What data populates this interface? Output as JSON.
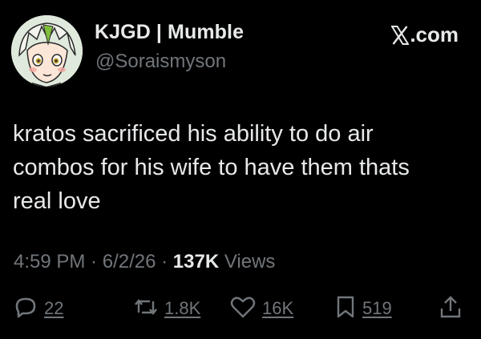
{
  "author": {
    "display_name": "KJGD | Mumble",
    "handle": "@Soraismyson",
    "avatar_icon": "anime-avatar"
  },
  "brand": {
    "label": ".com",
    "icon": "x-logo-icon"
  },
  "tweet": {
    "lines": [
      "kratos sacrificed his ability to do air",
      "combos for his wife to have them thats",
      "real love"
    ]
  },
  "meta": {
    "time": "4:59 PM",
    "separator": " · ",
    "date": "6/2/26",
    "views_count": "137K",
    "views_label": " Views"
  },
  "actions": {
    "reply_count": "22",
    "repost_count": "1.8K",
    "like_count": "16K",
    "bookmark_count": "519"
  },
  "colors": {
    "background": "#000000",
    "primary_text": "#e7e9ea",
    "secondary_text": "#71767b"
  }
}
